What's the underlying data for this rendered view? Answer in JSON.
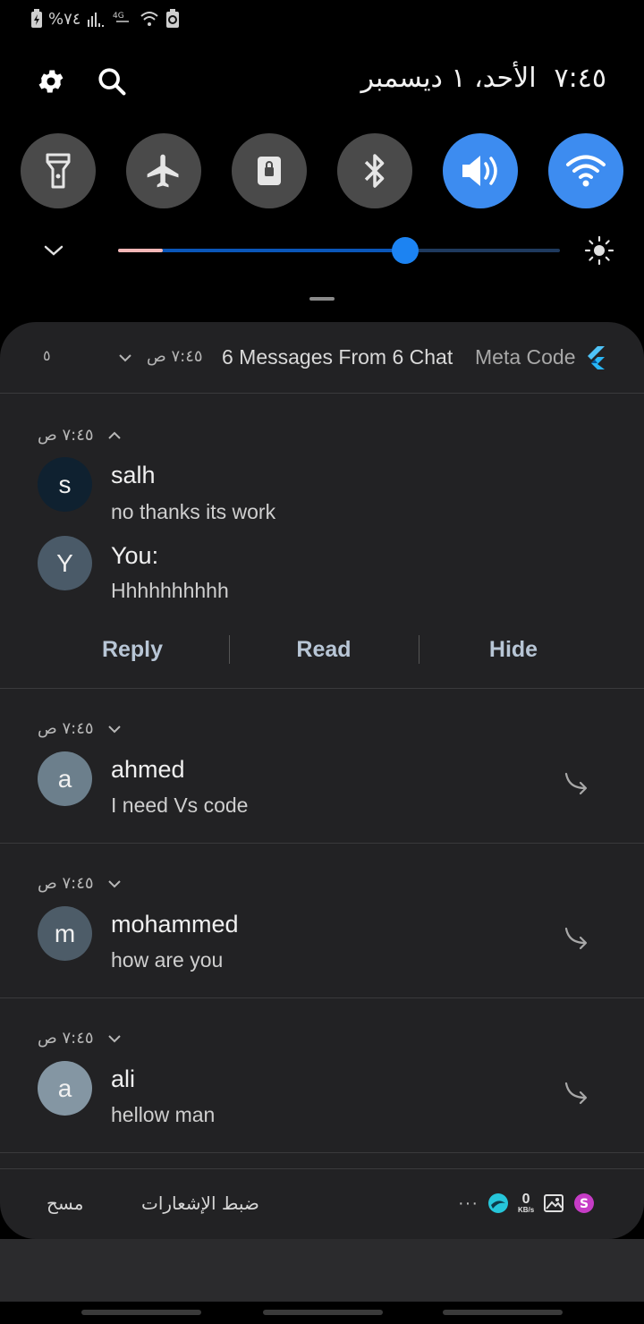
{
  "status_bar": {
    "battery_text": "%٧٤"
  },
  "header": {
    "time": "٧:٤٥",
    "date": "الأحد، ١ ديسمبر"
  },
  "quick_toggles": [
    {
      "name": "flashlight",
      "icon": "flashlight-icon",
      "on": false
    },
    {
      "name": "airplane",
      "icon": "airplane-icon",
      "on": false
    },
    {
      "name": "lock",
      "icon": "lock-icon",
      "on": false
    },
    {
      "name": "bluetooth",
      "icon": "bluetooth-icon",
      "on": false
    },
    {
      "name": "sound",
      "icon": "volume-icon",
      "on": true
    },
    {
      "name": "wifi",
      "icon": "wifi-icon",
      "on": true
    }
  ],
  "brightness": {
    "level_fraction": 0.65
  },
  "notification": {
    "app_name": "Meta Code",
    "summary": "6 Messages From 6 Chat",
    "time": "٧:٤٥ ص",
    "count": "٥",
    "groups": [
      {
        "time": "٧:٤٥ ص",
        "expanded": true,
        "messages": [
          {
            "initial": "s",
            "sender": "salh",
            "text": "no thanks its work",
            "color": "#0f2130"
          },
          {
            "initial": "Y",
            "sender": "You:",
            "text": "Hhhhhhhhhh",
            "color": "#4a5a68"
          }
        ],
        "actions": [
          "Reply",
          "Read",
          "Hide"
        ]
      },
      {
        "time": "٧:٤٥ ص",
        "expanded": false,
        "messages": [
          {
            "initial": "a",
            "sender": "ahmed",
            "text": "I need Vs code",
            "color": "#6c7f8c"
          }
        ]
      },
      {
        "time": "٧:٤٥ ص",
        "expanded": false,
        "messages": [
          {
            "initial": "m",
            "sender": "mohammed",
            "text": "how are you",
            "color": "#4d5c68"
          }
        ]
      },
      {
        "time": "٧:٤٥ ص",
        "expanded": false,
        "messages": [
          {
            "initial": "a",
            "sender": "ali",
            "text": "hellow man",
            "color": "#8496a3"
          }
        ]
      }
    ]
  },
  "footer": {
    "clear_label": "مسح",
    "settings_label": "ضبط الإشعارات",
    "more": "···",
    "speed_value": "0",
    "speed_unit": "KB/s"
  }
}
